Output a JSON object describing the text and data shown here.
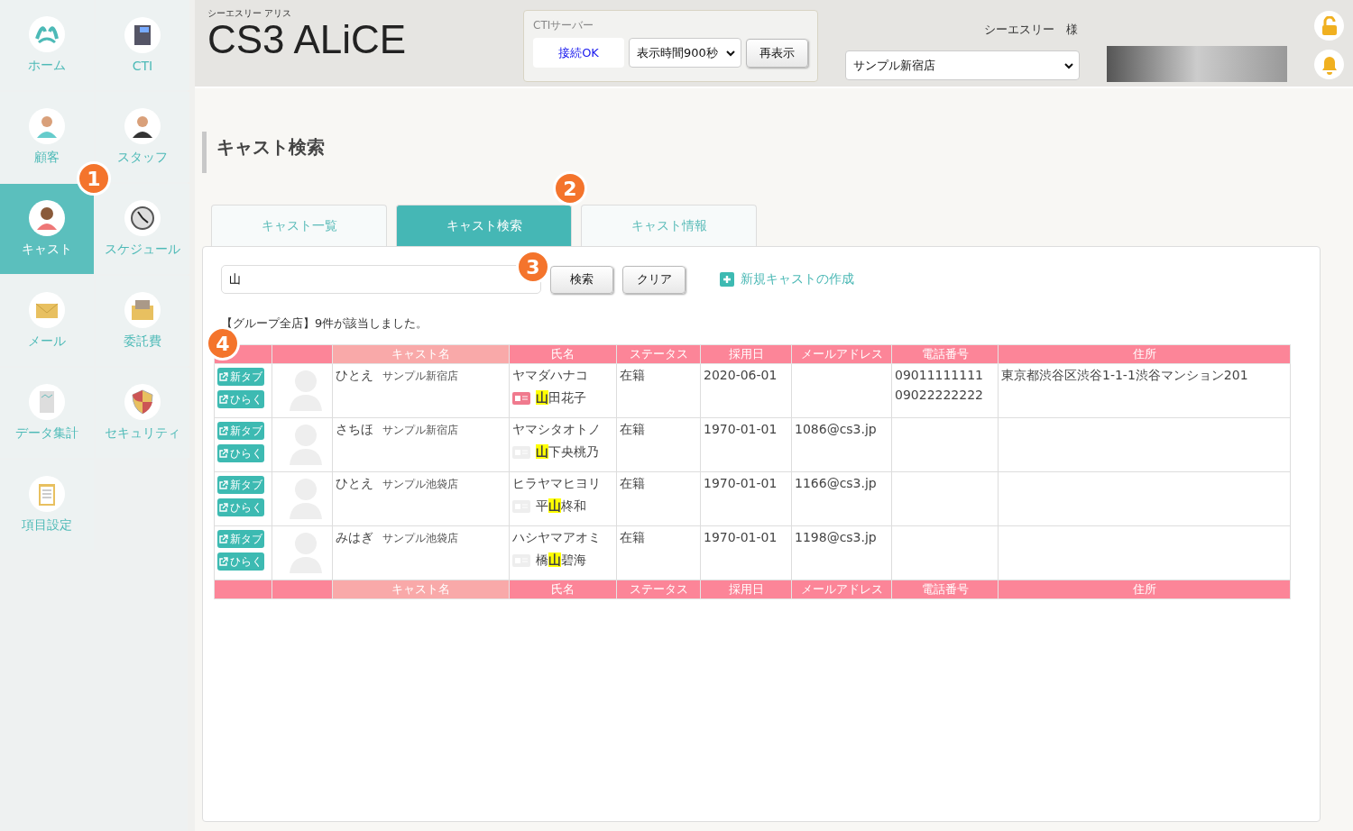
{
  "sidebar": {
    "items": [
      {
        "label": "ホーム",
        "selected": false
      },
      {
        "label": "CTI",
        "selected": false
      },
      {
        "label": "顧客",
        "selected": false
      },
      {
        "label": "スタッフ",
        "selected": false
      },
      {
        "label": "キャスト",
        "selected": true
      },
      {
        "label": "スケジュール",
        "selected": false
      },
      {
        "label": "メール",
        "selected": false
      },
      {
        "label": "委託費",
        "selected": false
      },
      {
        "label": "データ集計",
        "selected": false
      },
      {
        "label": "セキュリティ",
        "selected": false
      },
      {
        "label": "項目設定",
        "selected": false
      }
    ]
  },
  "header": {
    "logo_caption": "シーエスリー アリス",
    "logo": "CS3 ALiCE",
    "cti": {
      "label": "CTIサーバー",
      "status": "接続OK",
      "interval": "表示時間900秒",
      "refresh": "再表示"
    },
    "user": "シーエスリー　様",
    "store": "サンプル新宿店"
  },
  "page_title": "キャスト検索",
  "tabs": [
    {
      "label": "キャスト一覧",
      "selected": false
    },
    {
      "label": "キャスト検索",
      "selected": true
    },
    {
      "label": "キャスト情報",
      "selected": false
    }
  ],
  "search": {
    "value": "山",
    "search_button": "検索",
    "clear_button": "クリア",
    "new_link": "新規キャストの作成"
  },
  "result_text": "【グループ全店】9件が該当しました。",
  "table": {
    "columns": [
      "キャスト名",
      "氏名",
      "ステータス",
      "採用日",
      "メールアドレス",
      "電話番号",
      "住所"
    ],
    "footer_columns": [
      "キャスト名",
      "氏名",
      "ステータス",
      "採用日",
      "メールアドレス",
      "電話番号",
      "住所"
    ],
    "rows": [
      {
        "new_tab": "新タブ",
        "open": "ひらく",
        "cast_name": "ひとえ",
        "store": "サンプル新宿店",
        "kana": "ヤマダハナコ",
        "name": "**山**田花子",
        "id_registered": true,
        "status": "在籍",
        "hired": "2020-06-01",
        "email": "",
        "phones": [
          "09011111111",
          "09022222222"
        ],
        "address": "東京都渋谷区渋谷1-1-1渋谷マンション201"
      },
      {
        "new_tab": "新タブ",
        "open": "ひらく",
        "cast_name": "さちほ",
        "store": "サンプル新宿店",
        "kana": "ヤマシタオトノ",
        "name": "**山**下央桃乃",
        "id_registered": false,
        "status": "在籍",
        "hired": "1970-01-01",
        "email": "1086@cs3.jp",
        "phones": [],
        "address": ""
      },
      {
        "new_tab": "新タブ",
        "open": "ひらく",
        "cast_name": "ひとえ",
        "store": "サンプル池袋店",
        "kana": "ヒラヤマヒヨリ",
        "name": "平**山**柊和",
        "id_registered": false,
        "status": "在籍",
        "hired": "1970-01-01",
        "email": "1166@cs3.jp",
        "phones": [],
        "address": ""
      },
      {
        "new_tab": "新タブ",
        "open": "ひらく",
        "cast_name": "みはぎ",
        "store": "サンプル池袋店",
        "kana": "ハシヤマアオミ",
        "name": "橋**山**碧海",
        "id_registered": false,
        "status": "在籍",
        "hired": "1970-01-01",
        "email": "1198@cs3.jp",
        "phones": [],
        "address": ""
      }
    ]
  },
  "callouts": [
    "1",
    "2",
    "3",
    "4"
  ]
}
